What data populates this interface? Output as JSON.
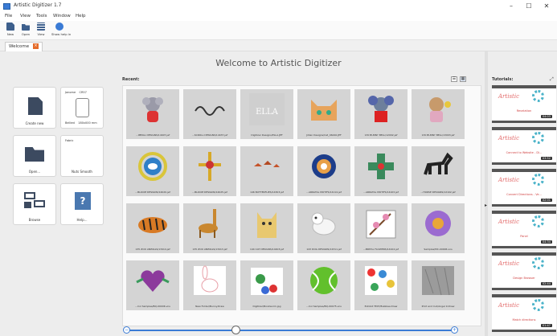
{
  "window": {
    "title": "Artistic Digitizer 1.7",
    "minimize_label": "–",
    "maximize_label": "☐",
    "close_label": "✕"
  },
  "menu": [
    "File",
    "View",
    "Tools",
    "Window",
    "Help"
  ],
  "toolbar": [
    {
      "label": "New",
      "icon": "new-file-icon"
    },
    {
      "label": "Open",
      "icon": "open-folder-icon"
    },
    {
      "label": "View",
      "icon": "view-grid-icon"
    },
    {
      "label": "Show help in",
      "icon": "help-icon"
    }
  ],
  "tabs": [
    {
      "label": "Welcome",
      "close_label": "×"
    }
  ],
  "welcome_title": "Welcome to Artistic Digitizer",
  "quick_actions": {
    "create_new": "Create new",
    "hoop_name": "Janome    CR57",
    "hoop_size": "Bellied    180x000 mm",
    "fabric_label": "Fabric",
    "fabric_value": "Nuts Smooth",
    "open": "Open...",
    "browse": "Browse",
    "help": "Help..."
  },
  "recent": {
    "label": "Recent:",
    "view_list_icon": "☰",
    "view_grid_icon": "▦",
    "items": [
      {
        "caption": "...IMMAL DESIGNS/14407.jef",
        "art": "koala"
      },
      {
        "caption": "...SCROLL DESIGNS/14437.jef",
        "art": "scroll"
      },
      {
        "caption": "Digitizer Designs/ELLA.JEF",
        "art": "ella"
      },
      {
        "caption": "Jillian Designs/Cat_46440.JEF",
        "art": "cat"
      },
      {
        "caption": "130 BUNNY BELL/12002.jef",
        "art": "koala2"
      },
      {
        "caption": "130 BUNNY BELL/13003.jef",
        "art": "bear"
      },
      {
        "caption": "...BLOOM DESIGNS/14020.jef",
        "art": "bird-circle"
      },
      {
        "caption": "...BLOOM DESIGNS/14025.jef",
        "art": "ornament"
      },
      {
        "caption": "146 BUTTERFLIES/14303.jef",
        "art": "butterflies"
      },
      {
        "caption": "...ARRATAL MOTIFS/14114.jef",
        "art": "mandala"
      },
      {
        "caption": "...ARRATAL MOTIFS/14103.jef",
        "art": "cross-motif"
      },
      {
        "caption": "...HORSE DESIGNS/12102.jef",
        "art": "horse"
      },
      {
        "caption": "135 ZOO ANIMALS/13414.jef",
        "art": "tiger"
      },
      {
        "caption": "135 ZOO ANIMALS/13413.jef",
        "art": "giraffe"
      },
      {
        "caption": "144 CAT DESIGNS/14403.jef",
        "art": "cat2"
      },
      {
        "caption": "143 DOG DESIGNS/14311.jef",
        "art": "dog"
      },
      {
        "caption": "...BRITAL FLOWERS/14102.jef",
        "art": "blossom"
      },
      {
        "caption": "Samples/MC-00006.vns",
        "art": "flower"
      },
      {
        "caption": "...Col Samples/BQ-00006.vns",
        "art": "heart"
      },
      {
        "caption": "New Folder/Bunny.Draw",
        "art": "bunny"
      },
      {
        "caption": "Digitizer/Bookworm.jpg",
        "art": "bookworm"
      },
      {
        "caption": "...Col Samples/BQ-00075.vns",
        "art": "tennis"
      },
      {
        "caption": "Exhibit TEXT/Bubbles.Draw",
        "art": "bubbles"
      },
      {
        "caption": "Print and Cut/Angel 9.Draw",
        "art": "fabric"
      }
    ]
  },
  "slider": {
    "value": 0.33,
    "minus_label": "−",
    "plus_label": "+"
  },
  "tutorials": {
    "label": "Tutorials:",
    "expand_label": "⤢",
    "logo": "Artistic",
    "items": [
      {
        "title": "Revelation",
        "duration": "04:03"
      },
      {
        "title": "Connect to Website - Di...",
        "duration": "03:52"
      },
      {
        "title": "Convert Directions - Ve...",
        "duration": "02:01"
      },
      {
        "title": "Panel",
        "duration": "04:34"
      },
      {
        "title": "Design Browser",
        "duration": "02:44"
      },
      {
        "title": "Match directions",
        "duration": "01:47"
      }
    ]
  },
  "colors": {
    "accent": "#3a7bd5",
    "tab_close": "#e46b2a",
    "tutorial_logo": "#e36a6a",
    "tutorial_gear": "#4bb3c9"
  }
}
